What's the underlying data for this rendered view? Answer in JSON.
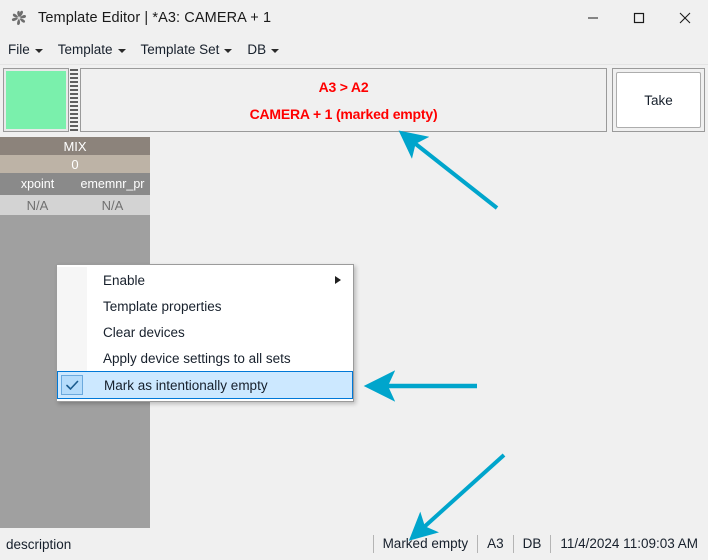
{
  "window": {
    "title": "Template Editor | *A3: CAMERA + 1",
    "icon": "pinwheel-app-icon",
    "controls": {
      "minimize": "minimize-icon",
      "maximize": "maximize-icon",
      "close": "close-icon"
    }
  },
  "menubar": {
    "items": [
      {
        "label": "File"
      },
      {
        "label": "Template"
      },
      {
        "label": "Template Set"
      },
      {
        "label": "DB"
      }
    ]
  },
  "topstrip": {
    "swatch_color": "#7af0ac",
    "banner": {
      "line1": "A3 > A2",
      "line2": "CAMERA + 1 (marked empty)",
      "text_color": "#ff0000"
    },
    "take_label": "Take"
  },
  "grid": {
    "mix_label": "MIX",
    "index_label": "0",
    "columns": [
      "xpoint",
      "ememnr_pr"
    ],
    "values": [
      "N/A",
      "N/A"
    ]
  },
  "context_menu": {
    "items": [
      {
        "label": "Enable",
        "has_submenu": true,
        "checked": false,
        "selected": false
      },
      {
        "label": "Template properties",
        "has_submenu": false,
        "checked": false,
        "selected": false
      },
      {
        "label": "Clear devices",
        "has_submenu": false,
        "checked": false,
        "selected": false
      },
      {
        "label": "Apply device settings to all sets",
        "has_submenu": false,
        "checked": false,
        "selected": false
      },
      {
        "label": "Mark as intentionally empty",
        "has_submenu": false,
        "checked": true,
        "selected": true
      }
    ],
    "highlight_fill": "#cce8ff",
    "highlight_border": "#0078d7",
    "check_glyph": "check-icon"
  },
  "statusbar": {
    "description": "description",
    "panels": [
      {
        "label": "Marked empty"
      },
      {
        "label": "A3"
      },
      {
        "label": "DB"
      },
      {
        "label": "11/4/2024 11:09:03 AM"
      }
    ]
  },
  "annotations": {
    "color": "#00a5cc",
    "arrows": [
      {
        "name": "arrow-to-banner",
        "points_to": "banner"
      },
      {
        "name": "arrow-to-mark-as-intentionally-empty",
        "points_to": "context-menu-selected-item"
      },
      {
        "name": "arrow-to-marked-empty-status",
        "points_to": "status-panel-marked-empty"
      }
    ]
  }
}
